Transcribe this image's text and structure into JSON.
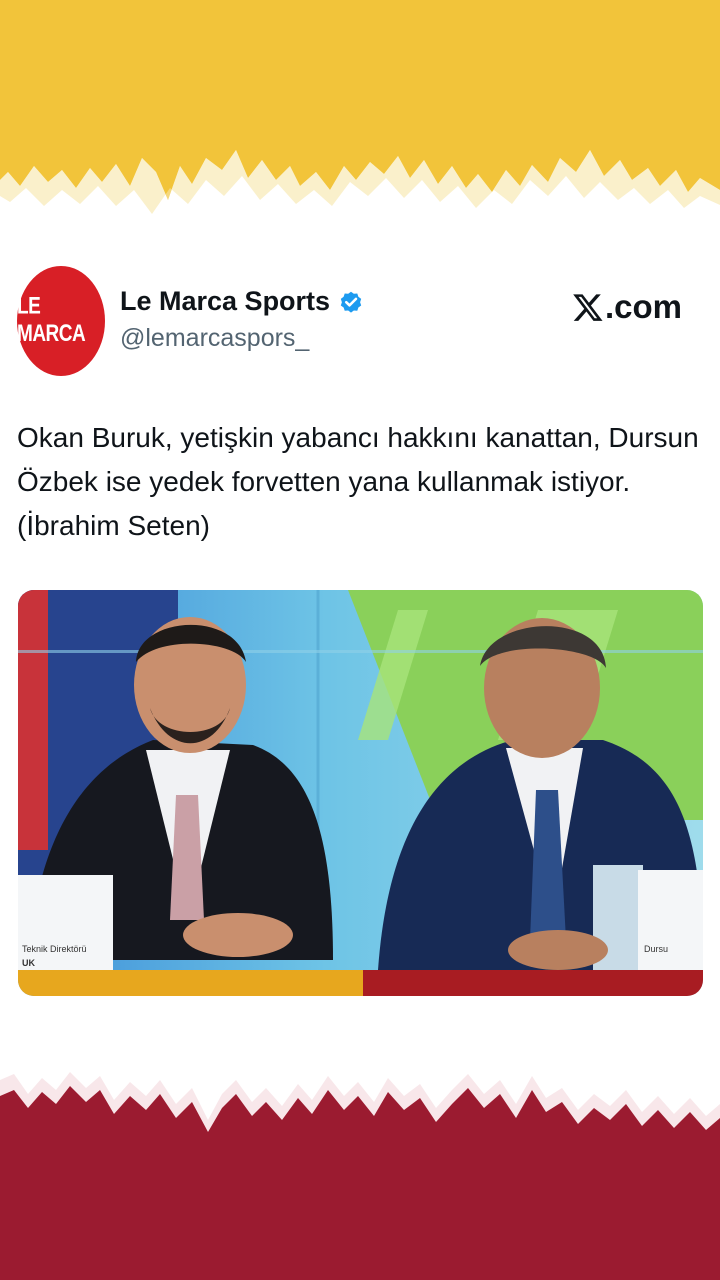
{
  "colors": {
    "top_band": "#f2c43a",
    "bottom_band": "#9b1b30",
    "avatar_bg": "#d81f26",
    "verified": "#1d9bf0",
    "name_text": "#0f1419",
    "handle_text": "#536471"
  },
  "tweet": {
    "avatar_text": "LE MARCA",
    "display_name": "Le Marca Sports",
    "handle": "@lemarcaspors_",
    "brand": ".com",
    "text": "Okan Buruk, yetişkin yabancı hakkını kanattan, Dursun Özbek ise yedek forvetten yana kullanmak istiyor. (İbrahim Seten)",
    "media": {
      "name_card_left": "Teknik Direktörü",
      "name_card_left_2": "UK",
      "name_card_right": "Dursu"
    }
  }
}
